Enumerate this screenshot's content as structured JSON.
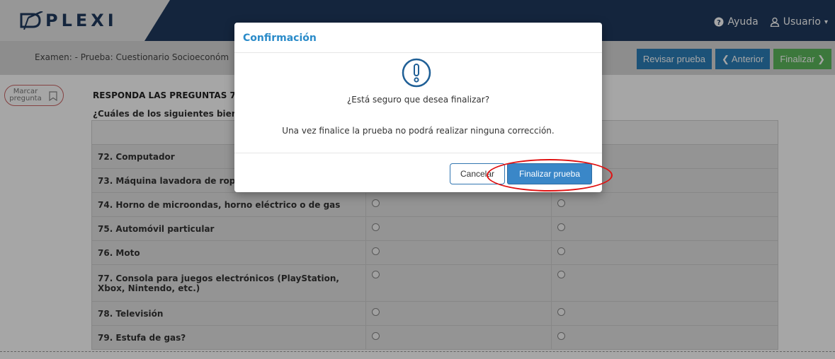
{
  "header": {
    "logo_text": "PLEXI",
    "help_label": "Ayuda",
    "user_label": "Usuario"
  },
  "toolbar": {
    "title": "Examen: - Prueba: Cuestionario Socioeconóm",
    "review_label": "Revisar prueba",
    "prev_label": "Anterior",
    "finish_label": "Finalizar"
  },
  "mark_question": {
    "label_line1": "Marcar",
    "label_line2": "pregunta"
  },
  "question": {
    "heading": "RESPONDA LAS PREGUNTAS 7",
    "subheading": "¿Cuáles de los siguientes bier"
  },
  "table": {
    "rows": [
      {
        "label": "72. Computador"
      },
      {
        "label": "73. Máquina lavadora de rop"
      },
      {
        "label": "74. Horno de microondas, horno eléctrico o de gas"
      },
      {
        "label": "75. Automóvil particular"
      },
      {
        "label": "76. Moto"
      },
      {
        "label": "77. Consola para juegos electrónicos (PlayStation,",
        "label2": "Xbox, Nintendo, etc.)"
      },
      {
        "label": "78. Televisión"
      },
      {
        "label": "79. Estufa de gas?"
      }
    ]
  },
  "modal": {
    "title": "Confirmación",
    "question": "¿Está seguro que desea finalizar?",
    "message": "Una vez finalice la prueba no podrá realizar ninguna corrección.",
    "cancel_label": "Cancelar",
    "confirm_label": "Finalizar prueba"
  },
  "colors": {
    "header_bg": "#1f3a5f",
    "accent_blue": "#2c7fb8",
    "finish_green": "#5cb85c",
    "modal_title": "#2a8bc9",
    "highlight_red": "#e01010"
  }
}
